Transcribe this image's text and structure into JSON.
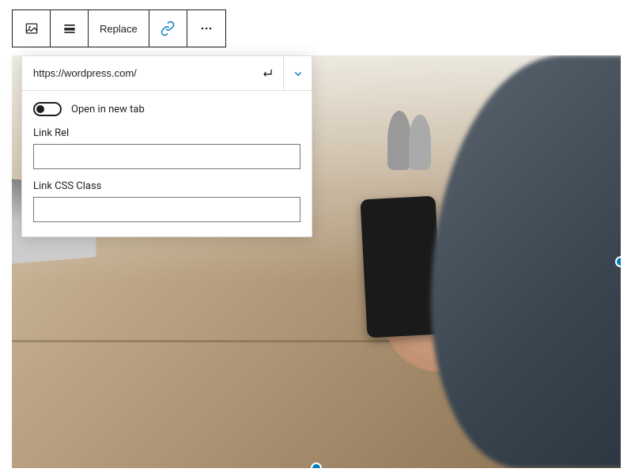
{
  "toolbar": {
    "replace_label": "Replace"
  },
  "link_panel": {
    "url": "https://wordpress.com/",
    "open_new_tab_label": "Open in new tab",
    "link_rel_label": "Link Rel",
    "link_rel_value": "",
    "link_css_class_label": "Link CSS Class",
    "link_css_class_value": ""
  },
  "colors": {
    "accent": "#007cba"
  }
}
